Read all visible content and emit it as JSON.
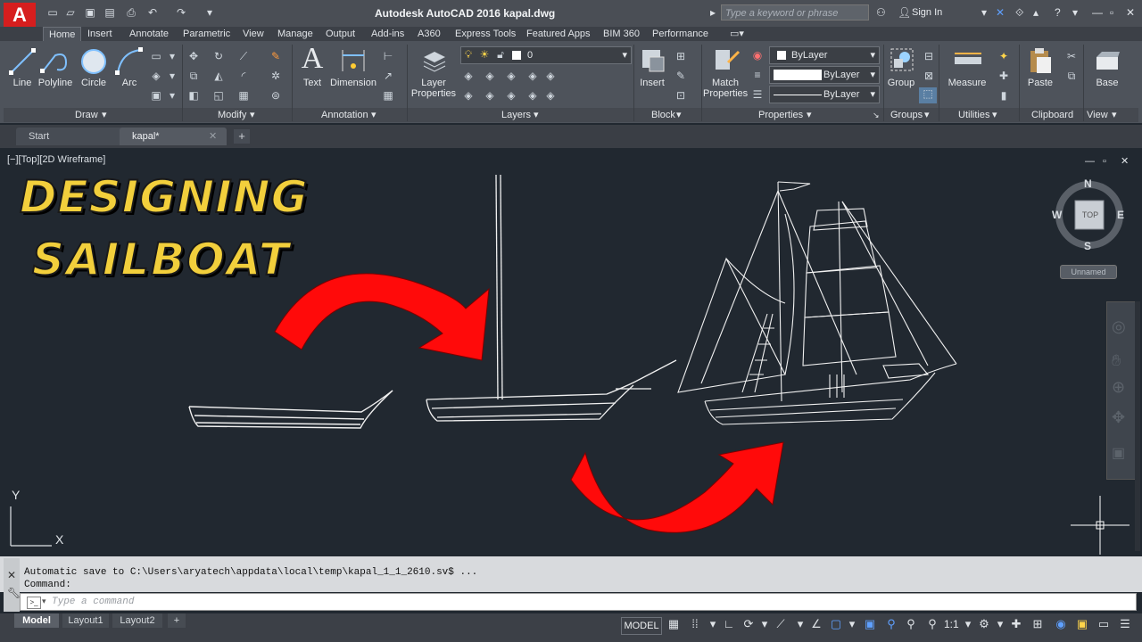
{
  "window": {
    "app_logo": "A",
    "title": "Autodesk AutoCAD 2016    kapal.dwg",
    "search_placeholder": "Type a keyword or phrase",
    "sign_in": "Sign In"
  },
  "ribbon_tabs": [
    "Home",
    "Insert",
    "Annotate",
    "Parametric",
    "View",
    "Manage",
    "Output",
    "Add-ins",
    "A360",
    "Express Tools",
    "Featured Apps",
    "BIM 360",
    "Performance"
  ],
  "ribbon": {
    "draw": {
      "title": "Draw",
      "line": "Line",
      "polyline": "Polyline",
      "circle": "Circle",
      "arc": "Arc"
    },
    "modify": {
      "title": "Modify"
    },
    "annotation": {
      "title": "Annotation",
      "text": "Text",
      "dimension": "Dimension"
    },
    "layers": {
      "title": "Layers",
      "layer_properties_1": "Layer",
      "layer_properties_2": "Properties",
      "current_layer": "0"
    },
    "block": {
      "title": "Block",
      "insert": "Insert"
    },
    "properties": {
      "title": "Properties",
      "match_1": "Match",
      "match_2": "Properties",
      "color": "ByLayer",
      "linetype": "ByLayer",
      "lineweight": "ByLayer"
    },
    "groups": {
      "title": "Groups",
      "group": "Group"
    },
    "utilities": {
      "title": "Utilities",
      "measure": "Measure"
    },
    "clipboard": {
      "title": "Clipboard",
      "paste": "Paste"
    },
    "view": {
      "title": "View",
      "base": "Base"
    }
  },
  "file_tabs": {
    "start": "Start",
    "current": "kapal*"
  },
  "viewport": {
    "label": "[−][Top][2D Wireframe]",
    "overlay_line1": "DESIGNING",
    "overlay_line2": "SAILBOAT",
    "viewcube": {
      "n": "N",
      "s": "S",
      "e": "E",
      "w": "W",
      "top": "TOP",
      "ucs": "Unnamed"
    },
    "ucs_x": "X",
    "ucs_y": "Y"
  },
  "command": {
    "history_1": "Automatic save to C:\\Users\\aryatech\\appdata\\local\\temp\\kapal_1_1_2610.sv$ ...",
    "history_2": "Command:",
    "placeholder": "Type a command"
  },
  "status": {
    "layout_tabs": [
      "Model",
      "Layout1",
      "Layout2"
    ],
    "model": "MODEL",
    "scale": "1:1"
  },
  "colors": {
    "accent_red": "#d61e1e",
    "arrow_red": "#ff0a0a",
    "text_gold": "#f2cf3c"
  }
}
